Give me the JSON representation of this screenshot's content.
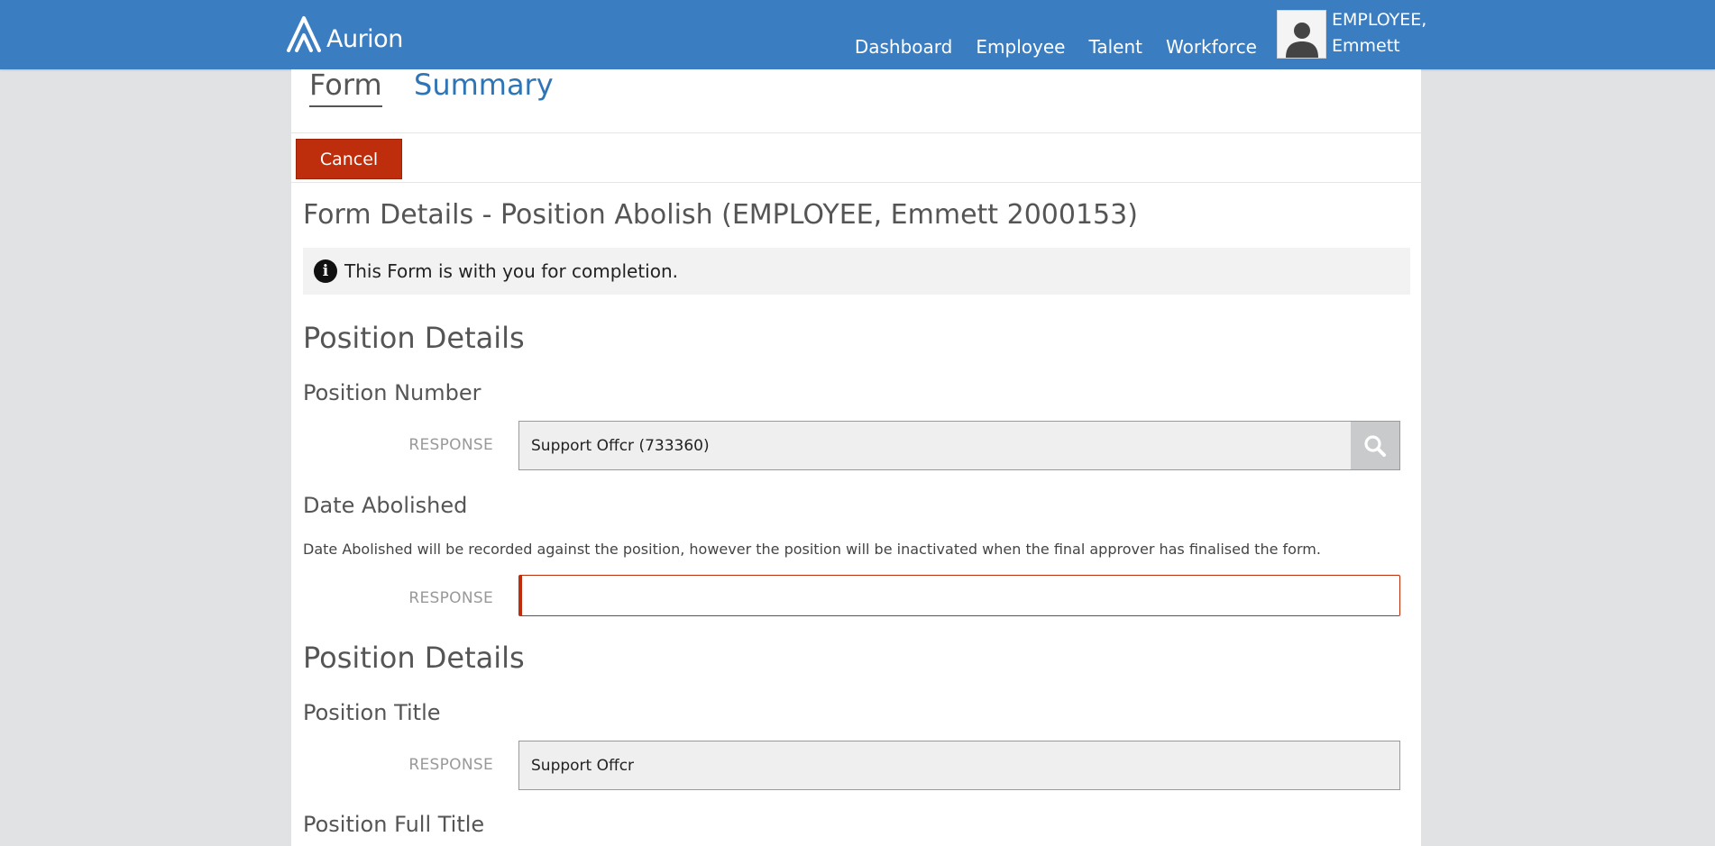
{
  "header": {
    "logo_text": "Aurion",
    "nav": [
      "Dashboard",
      "Employee",
      "Talent",
      "Workforce"
    ],
    "user_line1": "EMPLOYEE,",
    "user_line2": "Emmett"
  },
  "tabs": {
    "form": "Form",
    "summary": "Summary"
  },
  "actions": {
    "cancel": "Cancel"
  },
  "form": {
    "title": "Form Details - Position Abolish (EMPLOYEE, Emmett 2000153)",
    "info": "This Form is with you for completion.",
    "response_label": "RESPONSE",
    "sections": [
      {
        "heading": "Position Details",
        "questions": [
          {
            "label": "Position Number",
            "value": "Support Offcr (733360)"
          },
          {
            "label": "Date Abolished",
            "description": "Date Abolished will be recorded against the position, however the position will be inactivated when the final approver has finalised the form.",
            "value": ""
          }
        ]
      },
      {
        "heading": "Position Details",
        "questions": [
          {
            "label": "Position Title",
            "value": "Support Offcr"
          },
          {
            "label": "Position Full Title"
          }
        ]
      }
    ]
  },
  "colors": {
    "header": "#3a7dc1",
    "cancel": "#be2e0d",
    "link": "#2f75b5"
  }
}
